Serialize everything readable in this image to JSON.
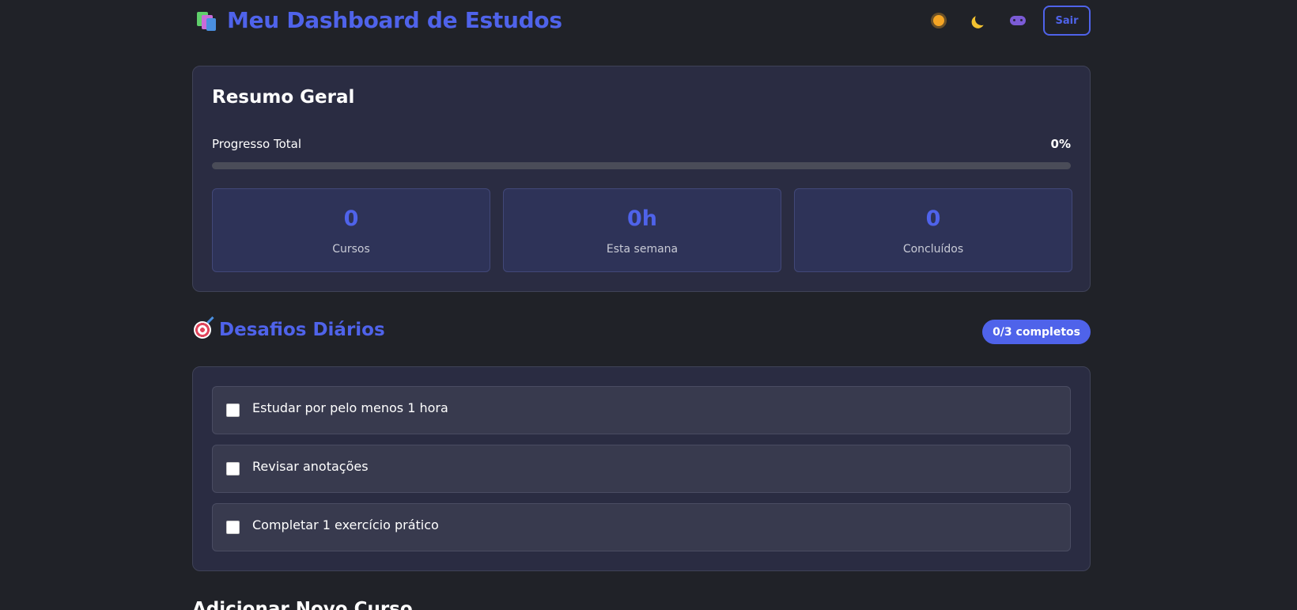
{
  "header": {
    "title": "Meu Dashboard de Estudos",
    "title_icon": "books-icon",
    "actions": [
      {
        "icon": "sun-icon",
        "label": "light-theme"
      },
      {
        "icon": "moon-icon",
        "label": "dark-theme"
      },
      {
        "icon": "gamepad-icon",
        "label": "game-theme"
      }
    ],
    "logout_label": "Sair"
  },
  "summary": {
    "title": "Resumo Geral",
    "progress_label": "Progresso Total",
    "progress_value_text": "0%",
    "progress_value": 0,
    "stats": [
      {
        "value": "0",
        "label": "Cursos"
      },
      {
        "value": "0h",
        "label": "Esta semana"
      },
      {
        "value": "0",
        "label": "Concluídos"
      }
    ]
  },
  "challenges": {
    "title": "Desafios Diários",
    "title_icon": "target-icon",
    "badge": "0/3 completos",
    "items": [
      {
        "text": "Estudar por pelo menos 1 hora",
        "checked": false
      },
      {
        "text": "Revisar anotações",
        "checked": false
      },
      {
        "text": "Completar 1 exercício prático",
        "checked": false
      }
    ]
  },
  "add_course": {
    "title": "Adicionar Novo Curso"
  },
  "colors": {
    "background": "#202228",
    "accent": "#4f63ea",
    "card": "#2a2c42",
    "stat_card": "#2e3358",
    "challenge_item": "#383a4e"
  }
}
